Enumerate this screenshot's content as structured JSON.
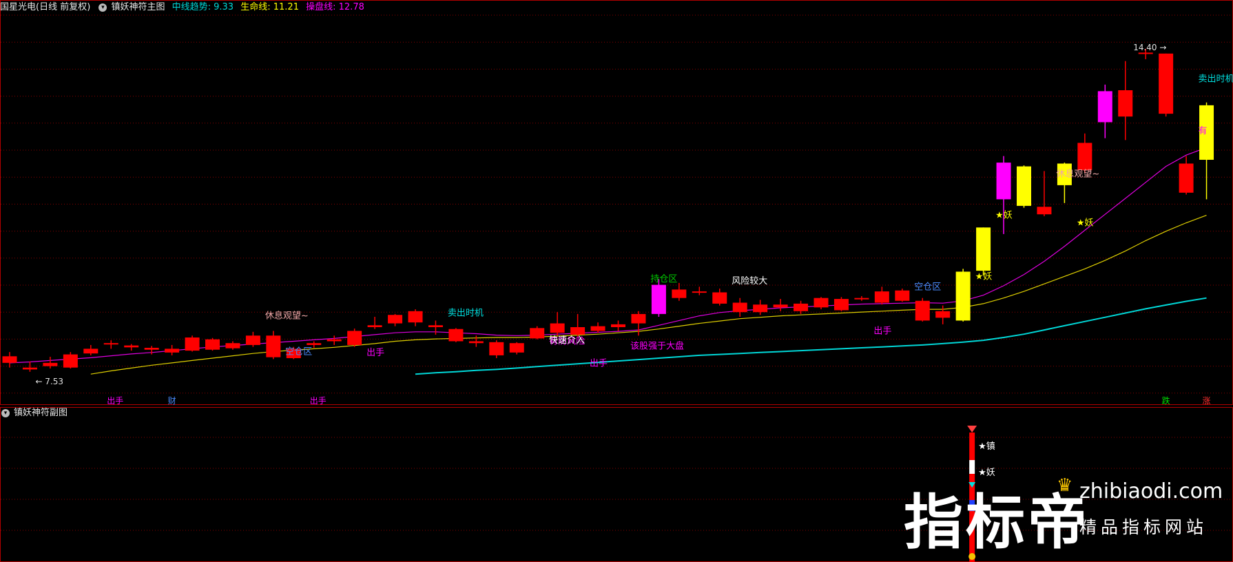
{
  "header": {
    "stock": "国星光电",
    "period": "(日线 前复权)",
    "indicator": "镇妖神符主图",
    "mid_label": "中线趋势:",
    "mid_value": "9.33",
    "life_label": "生命线:",
    "life_value": "11.21",
    "ctrl_label": "操盘线:",
    "ctrl_value": "12.78",
    "sub_indicator": "镇妖神符副图"
  },
  "colors": {
    "up": "#ff0000",
    "magenta": "#ff00ff",
    "yellow": "#ffff00",
    "mid_line": "#00d8d8",
    "life_line": "#e0d000",
    "ctrl_line": "#e000e0",
    "grid": "#8a0000"
  },
  "chart_data": {
    "type": "candlestick",
    "price_range": [
      7.0,
      15.0
    ],
    "min_label": "7.53",
    "max_label": "14.40",
    "candles": [
      {
        "o": 7.72,
        "h": 7.95,
        "l": 7.62,
        "c": 7.86,
        "col": "red"
      },
      {
        "o": 7.62,
        "h": 7.75,
        "l": 7.53,
        "c": 7.58,
        "col": "red"
      },
      {
        "o": 7.65,
        "h": 7.85,
        "l": 7.6,
        "c": 7.72,
        "col": "red"
      },
      {
        "o": 7.62,
        "h": 7.95,
        "l": 7.6,
        "c": 7.9,
        "col": "red"
      },
      {
        "o": 7.92,
        "h": 8.1,
        "l": 7.88,
        "c": 8.02,
        "col": "red"
      },
      {
        "o": 8.12,
        "h": 8.2,
        "l": 8.02,
        "c": 8.14,
        "col": "red"
      },
      {
        "o": 8.05,
        "h": 8.12,
        "l": 7.98,
        "c": 8.09,
        "col": "red"
      },
      {
        "o": 8.0,
        "h": 8.08,
        "l": 7.9,
        "c": 8.04,
        "col": "red"
      },
      {
        "o": 7.94,
        "h": 8.1,
        "l": 7.88,
        "c": 8.02,
        "col": "red"
      },
      {
        "o": 7.98,
        "h": 8.3,
        "l": 7.96,
        "c": 8.26,
        "col": "red"
      },
      {
        "o": 8.0,
        "h": 8.25,
        "l": 7.98,
        "c": 8.22,
        "col": "red"
      },
      {
        "o": 8.03,
        "h": 8.18,
        "l": 8.0,
        "c": 8.14,
        "col": "red"
      },
      {
        "o": 8.1,
        "h": 8.38,
        "l": 8.06,
        "c": 8.3,
        "col": "red"
      },
      {
        "o": 7.84,
        "h": 8.4,
        "l": 7.8,
        "c": 8.3,
        "col": "red"
      },
      {
        "o": 7.82,
        "h": 8.06,
        "l": 7.8,
        "c": 8.02,
        "col": "red"
      },
      {
        "o": 8.1,
        "h": 8.18,
        "l": 8.04,
        "c": 8.14,
        "col": "red"
      },
      {
        "o": 8.18,
        "h": 8.3,
        "l": 8.1,
        "c": 8.22,
        "col": "red"
      },
      {
        "o": 8.1,
        "h": 8.45,
        "l": 8.06,
        "c": 8.4,
        "col": "red"
      },
      {
        "o": 8.48,
        "h": 8.7,
        "l": 8.44,
        "c": 8.52,
        "col": "red"
      },
      {
        "o": 8.56,
        "h": 8.76,
        "l": 8.5,
        "c": 8.74,
        "col": "red"
      },
      {
        "o": 8.58,
        "h": 8.86,
        "l": 8.5,
        "c": 8.82,
        "col": "red"
      },
      {
        "o": 8.48,
        "h": 8.62,
        "l": 8.32,
        "c": 8.52,
        "col": "red"
      },
      {
        "o": 8.18,
        "h": 8.46,
        "l": 8.16,
        "c": 8.44,
        "col": "red"
      },
      {
        "o": 8.14,
        "h": 8.3,
        "l": 8.06,
        "c": 8.18,
        "col": "red"
      },
      {
        "o": 7.88,
        "h": 8.2,
        "l": 7.82,
        "c": 8.16,
        "col": "red"
      },
      {
        "o": 7.94,
        "h": 8.16,
        "l": 7.9,
        "c": 8.14,
        "col": "red"
      },
      {
        "o": 8.24,
        "h": 8.5,
        "l": 8.22,
        "c": 8.46,
        "col": "red"
      },
      {
        "o": 8.36,
        "h": 8.8,
        "l": 8.3,
        "c": 8.56,
        "col": "red"
      },
      {
        "o": 8.32,
        "h": 8.76,
        "l": 8.28,
        "c": 8.48,
        "col": "red"
      },
      {
        "o": 8.4,
        "h": 8.58,
        "l": 8.36,
        "c": 8.5,
        "col": "red"
      },
      {
        "o": 8.48,
        "h": 8.62,
        "l": 8.4,
        "c": 8.54,
        "col": "red"
      },
      {
        "o": 8.56,
        "h": 8.82,
        "l": 8.3,
        "c": 8.76,
        "col": "red"
      },
      {
        "o": 8.76,
        "h": 9.5,
        "l": 8.7,
        "c": 9.38,
        "col": "magenta"
      },
      {
        "o": 9.1,
        "h": 9.42,
        "l": 9.04,
        "c": 9.28,
        "col": "red"
      },
      {
        "o": 9.22,
        "h": 9.34,
        "l": 9.16,
        "c": 9.24,
        "col": "red"
      },
      {
        "o": 8.98,
        "h": 9.3,
        "l": 8.94,
        "c": 9.22,
        "col": "red"
      },
      {
        "o": 8.8,
        "h": 9.1,
        "l": 8.7,
        "c": 9.0,
        "col": "red"
      },
      {
        "o": 8.8,
        "h": 9.06,
        "l": 8.74,
        "c": 8.96,
        "col": "red"
      },
      {
        "o": 8.9,
        "h": 9.08,
        "l": 8.82,
        "c": 8.96,
        "col": "red"
      },
      {
        "o": 8.82,
        "h": 9.04,
        "l": 8.76,
        "c": 8.98,
        "col": "red"
      },
      {
        "o": 8.9,
        "h": 9.12,
        "l": 8.86,
        "c": 9.1,
        "col": "red"
      },
      {
        "o": 8.84,
        "h": 9.12,
        "l": 8.82,
        "c": 9.08,
        "col": "red"
      },
      {
        "o": 9.08,
        "h": 9.14,
        "l": 9.04,
        "c": 9.1,
        "col": "red"
      },
      {
        "o": 9.0,
        "h": 9.34,
        "l": 8.96,
        "c": 9.24,
        "col": "red"
      },
      {
        "o": 9.04,
        "h": 9.3,
        "l": 9.02,
        "c": 9.26,
        "col": "red"
      },
      {
        "o": 8.62,
        "h": 9.1,
        "l": 8.6,
        "c": 9.04,
        "col": "red"
      },
      {
        "o": 8.68,
        "h": 8.94,
        "l": 8.54,
        "c": 8.82,
        "col": "red"
      },
      {
        "o": 8.62,
        "h": 9.72,
        "l": 8.6,
        "c": 9.66,
        "col": "yellow"
      },
      {
        "o": 9.68,
        "h": 10.6,
        "l": 9.58,
        "c": 10.6,
        "col": "yellow"
      },
      {
        "o": 11.2,
        "h": 12.12,
        "l": 10.46,
        "c": 11.98,
        "col": "magenta"
      },
      {
        "o": 11.06,
        "h": 11.92,
        "l": 11.02,
        "c": 11.9,
        "col": "yellow"
      },
      {
        "o": 10.88,
        "h": 11.8,
        "l": 10.84,
        "c": 11.04,
        "col": "red"
      },
      {
        "o": 11.5,
        "h": 11.98,
        "l": 11.12,
        "c": 11.96,
        "col": "yellow"
      },
      {
        "o": 11.82,
        "h": 12.6,
        "l": 11.76,
        "c": 12.4,
        "col": "red"
      },
      {
        "o": 12.84,
        "h": 13.64,
        "l": 12.5,
        "c": 13.5,
        "col": "magenta"
      },
      {
        "o": 12.96,
        "h": 14.14,
        "l": 12.46,
        "c": 13.52,
        "col": "red"
      },
      {
        "o": 14.32,
        "h": 14.4,
        "l": 14.18,
        "c": 14.32,
        "col": "red"
      },
      {
        "o": 13.02,
        "h": 14.3,
        "l": 12.96,
        "c": 14.3,
        "col": "red"
      },
      {
        "o": 11.34,
        "h": 12.12,
        "l": 11.3,
        "c": 11.96,
        "col": "red"
      },
      {
        "o": 12.04,
        "h": 13.26,
        "l": 11.2,
        "c": 13.2,
        "col": "yellow"
      }
    ],
    "lines": {
      "ctrl": [
        7.72,
        7.74,
        7.77,
        7.8,
        7.83,
        7.87,
        7.91,
        7.94,
        7.98,
        8.02,
        8.06,
        8.09,
        8.12,
        8.15,
        8.18,
        8.21,
        8.24,
        8.28,
        8.32,
        8.36,
        8.38,
        8.38,
        8.36,
        8.34,
        8.31,
        8.3,
        8.31,
        8.33,
        8.35,
        8.37,
        8.39,
        8.42,
        8.52,
        8.62,
        8.72,
        8.79,
        8.83,
        8.86,
        8.89,
        8.91,
        8.93,
        8.95,
        8.97,
        8.98,
        8.99,
        9.0,
        8.99,
        9.04,
        9.16,
        9.36,
        9.6,
        9.88,
        10.2,
        10.54,
        10.88,
        11.22,
        11.56,
        11.9,
        12.14,
        12.3
      ],
      "life": [
        null,
        null,
        null,
        null,
        7.48,
        7.55,
        7.61,
        7.67,
        7.72,
        7.77,
        7.82,
        7.87,
        7.92,
        7.96,
        7.99,
        8.02,
        8.05,
        8.09,
        8.13,
        8.18,
        8.21,
        8.23,
        8.24,
        8.25,
        8.26,
        8.26,
        8.27,
        8.29,
        8.31,
        8.33,
        8.36,
        8.39,
        8.44,
        8.5,
        8.56,
        8.61,
        8.66,
        8.69,
        8.72,
        8.74,
        8.76,
        8.78,
        8.8,
        8.82,
        8.84,
        8.86,
        8.86,
        8.9,
        8.98,
        9.1,
        9.24,
        9.4,
        9.56,
        9.72,
        9.9,
        10.1,
        10.32,
        10.52,
        10.7,
        10.86
      ],
      "mid": [
        null,
        null,
        null,
        null,
        null,
        null,
        null,
        null,
        null,
        null,
        null,
        null,
        null,
        null,
        null,
        null,
        null,
        null,
        null,
        null,
        7.48,
        7.51,
        7.53,
        7.56,
        7.58,
        7.61,
        7.64,
        7.67,
        7.7,
        7.73,
        7.76,
        7.79,
        7.82,
        7.85,
        7.88,
        7.9,
        7.92,
        7.94,
        7.96,
        7.98,
        8.0,
        8.02,
        8.04,
        8.06,
        8.08,
        8.1,
        8.13,
        8.16,
        8.2,
        8.26,
        8.33,
        8.42,
        8.51,
        8.6,
        8.69,
        8.78,
        8.87,
        8.95,
        9.03,
        9.1
      ]
    },
    "annotations": [
      {
        "i": 13,
        "price": 8.66,
        "text": "休息观望~",
        "color": "#f0a8a8"
      },
      {
        "i": 14,
        "price": 7.9,
        "text": "空仓区",
        "color": "#4a8cff"
      },
      {
        "i": 18,
        "price": 7.88,
        "text": "出手",
        "color": "#ff00ff"
      },
      {
        "i": 22,
        "price": 8.72,
        "text": "卖出时机",
        "color": "#00e0e0"
      },
      {
        "i": 27,
        "price": 8.12,
        "text": "有防风险",
        "color": "#ff00ff"
      },
      {
        "i": 27,
        "price": 8.14,
        "text": "快速介入",
        "color": "#ffffff"
      },
      {
        "i": 31,
        "price": 8.02,
        "text": "该股强于大盘",
        "color": "#ff00ff"
      },
      {
        "i": 29,
        "price": 7.65,
        "text": "出手",
        "color": "#ff00ff"
      },
      {
        "i": 32,
        "price": 9.45,
        "text": "持仓区",
        "color": "#00c800"
      },
      {
        "i": 36,
        "price": 9.4,
        "text": "风险较大",
        "color": "#ffffff"
      },
      {
        "i": 43,
        "price": 8.34,
        "text": "出手",
        "color": "#ff00ff"
      },
      {
        "i": 45,
        "price": 9.28,
        "text": "空仓区",
        "color": "#4a8cff"
      },
      {
        "i": 48,
        "price": 9.5,
        "text": "★妖",
        "color": "#ffff00"
      },
      {
        "i": 49,
        "price": 10.8,
        "text": "★妖",
        "color": "#ffff00"
      },
      {
        "i": 52,
        "price": 11.68,
        "text": "休息观望~",
        "color": "#f0a8a8"
      },
      {
        "i": 53,
        "price": 10.64,
        "text": "★妖",
        "color": "#ffff00"
      },
      {
        "i": 59,
        "price": 13.7,
        "text": "卖出时机",
        "color": "#00e0e0"
      },
      {
        "i": 59,
        "price": 12.6,
        "text": "有",
        "color": "#ff00ff"
      }
    ],
    "bottom_labels": [
      {
        "i": 5,
        "text": "出手",
        "color": "#ff00ff"
      },
      {
        "i": 8,
        "text": "财",
        "color": "#4a8cff"
      },
      {
        "i": 15,
        "text": "出手",
        "color": "#ff00ff"
      },
      {
        "i": 57,
        "text": "跌",
        "color": "#00e000"
      },
      {
        "i": 59,
        "text": "涨",
        "color": "#ff3030"
      }
    ],
    "sub_signals": [
      {
        "text": "★镇",
        "color": "#ffffff"
      },
      {
        "text": "★妖",
        "color": "#ffffff"
      }
    ]
  },
  "watermark": {
    "big": "指标帝",
    "url": "zhibiaodi.com",
    "sub": "精品指标网站"
  }
}
